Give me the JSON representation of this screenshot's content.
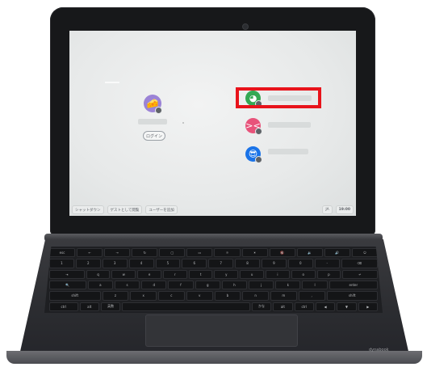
{
  "login_screen": {
    "sign_in_button": "ログイン",
    "users": [
      {
        "avatar_icon": "avatar-green-face-icon",
        "color": "#34a853",
        "selected": true
      },
      {
        "avatar_icon": "avatar-pink-face-icon",
        "color": "#e8537a",
        "selected": false
      },
      {
        "avatar_icon": "avatar-blue-sunglasses-icon",
        "color": "#1a73e8",
        "selected": false
      }
    ],
    "main_user": {
      "avatar_icon": "avatar-cheese-icon",
      "color": "#9b83d6"
    },
    "highlight_color": "#e8131b"
  },
  "shelf": {
    "shutdown": "シャットダウン",
    "add_person": "ユーザーを追加",
    "guest": "ゲストとして閲覧",
    "time": "19:00",
    "ime": "JA",
    "status": "ネットワーク"
  },
  "hardware": {
    "brand": "dynabook"
  }
}
